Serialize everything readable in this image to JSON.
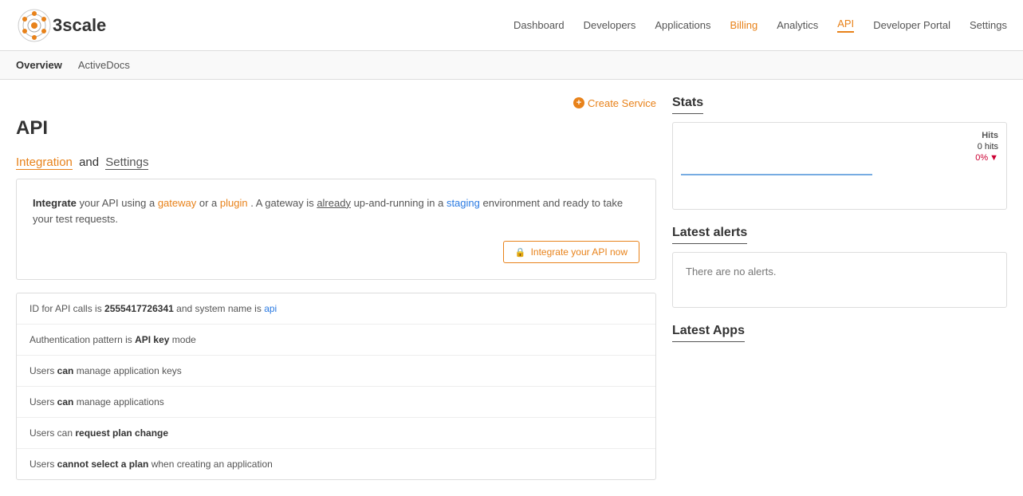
{
  "app": {
    "name": "3scale"
  },
  "nav": {
    "items": [
      {
        "label": "Dashboard",
        "id": "dashboard",
        "active": false
      },
      {
        "label": "Developers",
        "id": "developers",
        "active": false
      },
      {
        "label": "Applications",
        "id": "applications",
        "active": false
      },
      {
        "label": "Billing",
        "id": "billing",
        "active": false,
        "special": "billing"
      },
      {
        "label": "Analytics",
        "id": "analytics",
        "active": false
      },
      {
        "label": "API",
        "id": "api",
        "active": true
      },
      {
        "label": "Developer Portal",
        "id": "developer-portal",
        "active": false
      },
      {
        "label": "Settings",
        "id": "settings",
        "active": false
      }
    ]
  },
  "subnav": {
    "items": [
      {
        "label": "Overview",
        "id": "overview",
        "active": true
      },
      {
        "label": "ActiveDocs",
        "id": "activedocs",
        "active": false
      }
    ]
  },
  "create_service": {
    "label": "Create Service",
    "icon": "+"
  },
  "page": {
    "title": "API"
  },
  "integration_section": {
    "heading_link1": "Integration",
    "heading_and": "and",
    "heading_link2": "Settings",
    "card": {
      "text_part1": "Integrate",
      "text_part2": " your API using a ",
      "gateway_link": "gateway",
      "text_part3": " or a ",
      "plugin_link": "plugin",
      "text_part4": ". A gateway is ",
      "already_text": "already",
      "text_part5": " up-and-running in a ",
      "staging_text": "staging",
      "text_part6": " environment and ready to take your test requests.",
      "integrate_now_btn": "Integrate your API now"
    },
    "api_info": [
      {
        "text": "ID for API calls is ",
        "value": "2555417726341",
        "text2": " and system name is ",
        "value2": "api"
      },
      {
        "text": "Authentication pattern is ",
        "value": "API key",
        "text2": " mode"
      },
      {
        "text": "Users ",
        "can": "can",
        "text2": " manage application keys"
      },
      {
        "text": "Users ",
        "can": "can",
        "text2": " manage applications"
      },
      {
        "text": "Users can ",
        "value": "request plan change"
      },
      {
        "text": "Users ",
        "cannot": "cannot select a plan",
        "text2": " when creating an application"
      }
    ]
  },
  "stats": {
    "title": "Stats",
    "hits_label": "Hits",
    "hits_value": "0 hits",
    "percent": "0%",
    "trend": "down"
  },
  "alerts": {
    "title": "Latest alerts",
    "empty_text": "There are no alerts."
  },
  "latest_apps": {
    "title": "Latest Apps"
  }
}
